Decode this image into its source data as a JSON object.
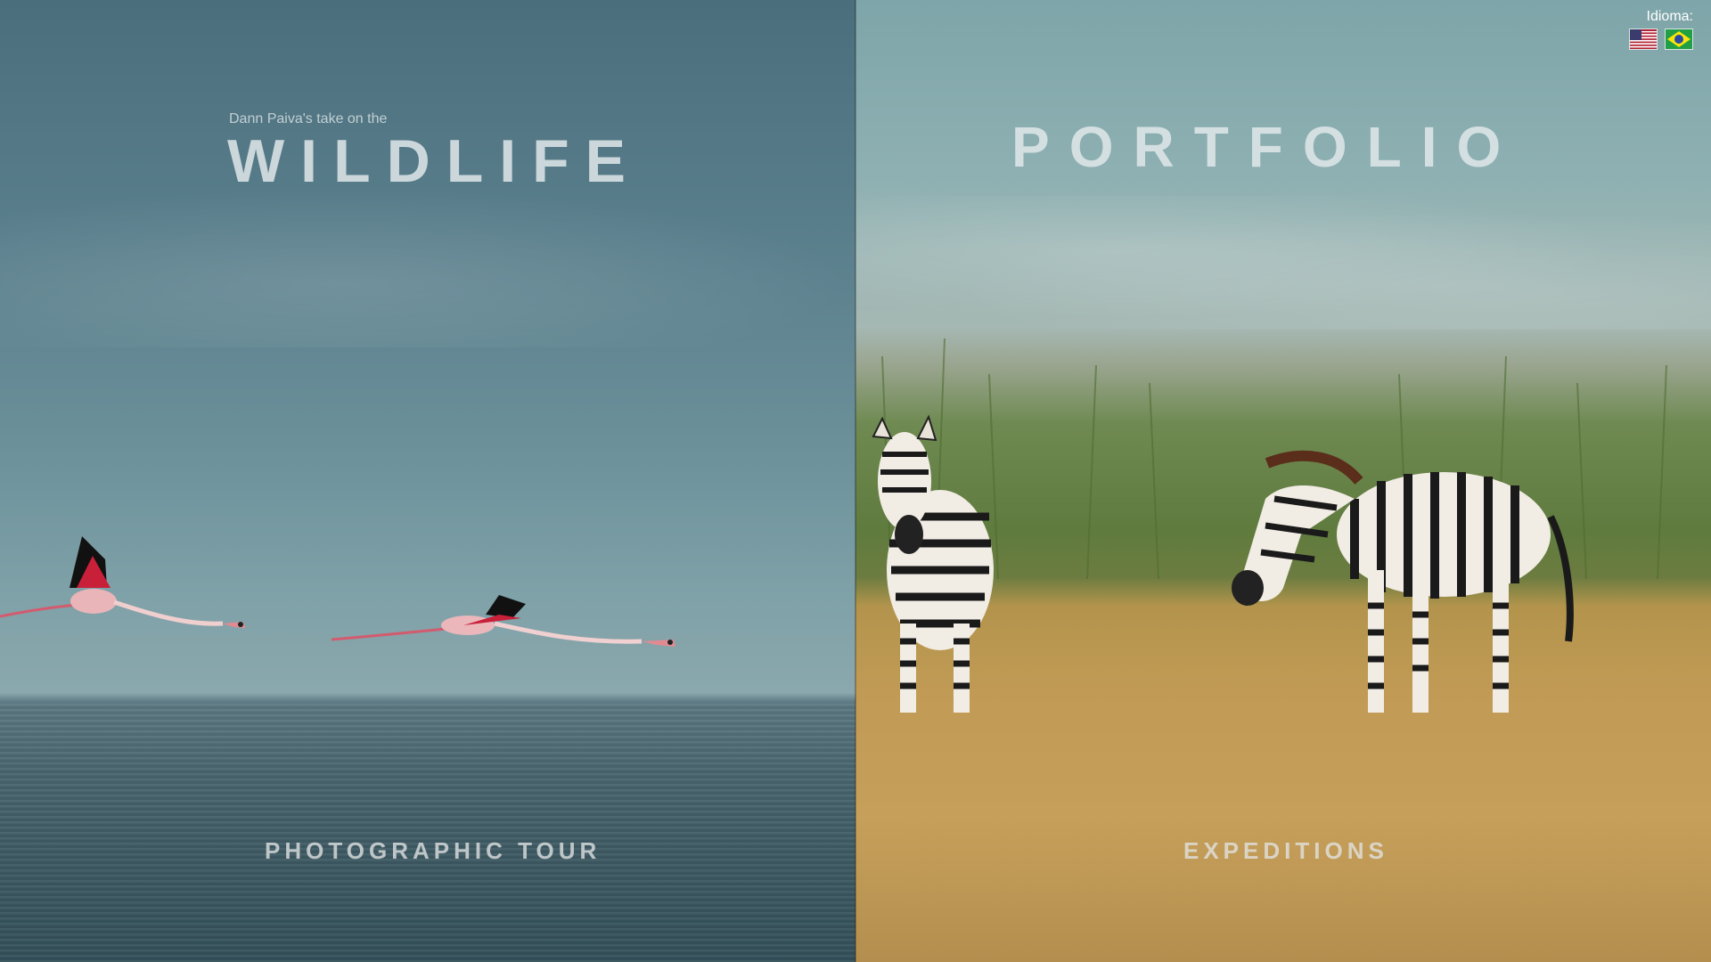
{
  "left_panel": {
    "subtitle": "Dann Paiva's take on the",
    "title": "WILDLIFE",
    "link": "PHOTOGRAPHIC TOUR"
  },
  "right_panel": {
    "title": "PORTFOLIO",
    "link": "EXPEDITIONS"
  },
  "language": {
    "label": "Idioma:",
    "options": [
      "en-us-flag-icon",
      "pt-br-flag-icon"
    ]
  },
  "colors": {
    "title_text": "#e1e8ea",
    "sky_left": "#5a7f8c",
    "water": "#3d5962",
    "savanna_grass": "#c19b55"
  }
}
